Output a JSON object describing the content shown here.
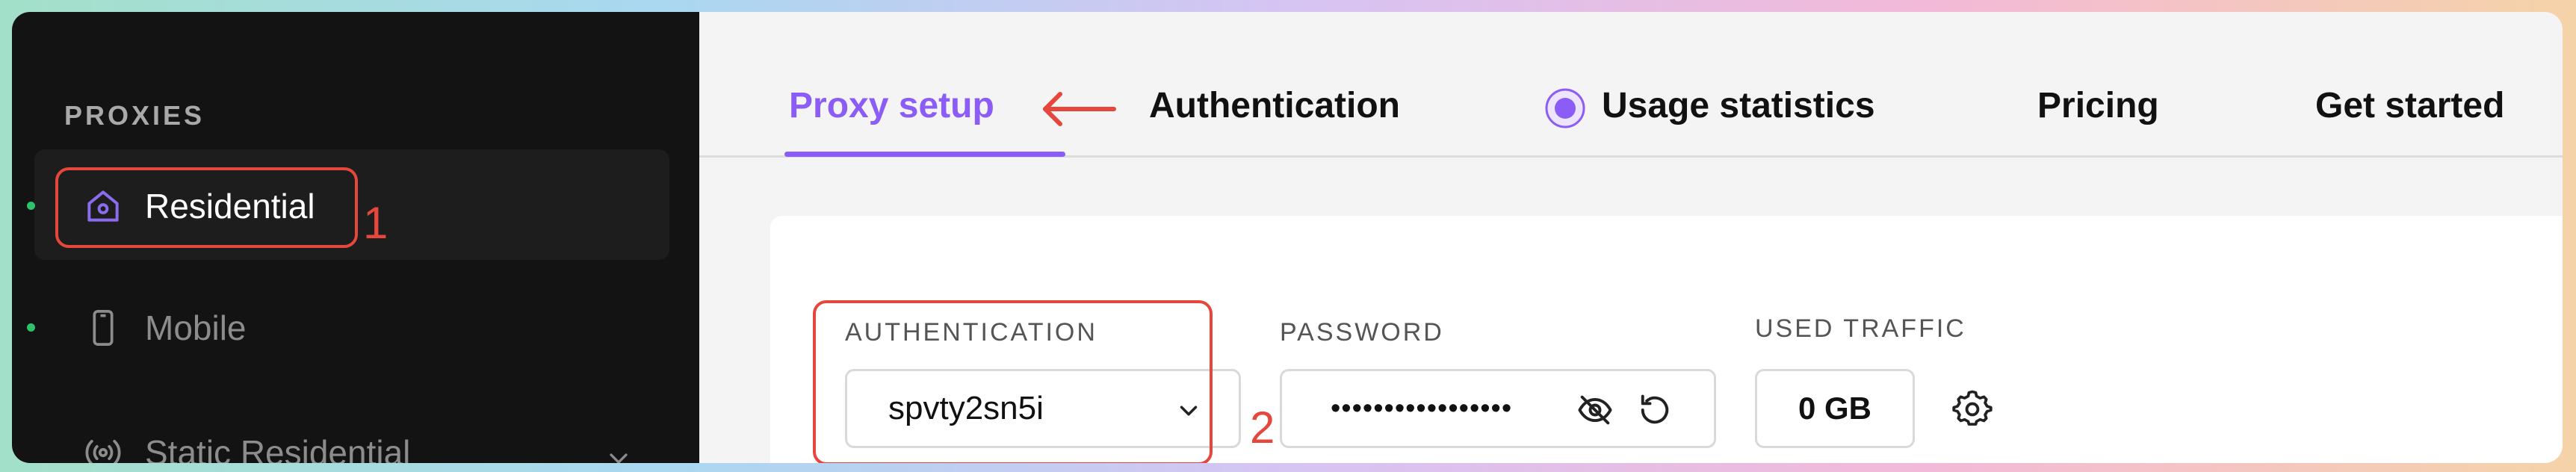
{
  "sidebar": {
    "section_title": "PROXIES",
    "items": [
      {
        "label": "Residential",
        "icon": "home-icon",
        "active": true
      },
      {
        "label": "Mobile",
        "icon": "phone-icon",
        "active": false
      },
      {
        "label": "Static Residential",
        "icon": "broadcast-icon",
        "active": false
      }
    ]
  },
  "tabs": [
    {
      "label": "Proxy setup",
      "active": true
    },
    {
      "label": "Authentication",
      "active": false
    },
    {
      "label": "Usage statistics",
      "active": false
    },
    {
      "label": "Pricing",
      "active": false
    },
    {
      "label": "Get started",
      "active": false
    }
  ],
  "form": {
    "authentication_label": "AUTHENTICATION",
    "authentication_value": "spvty2sn5i",
    "password_label": "PASSWORD",
    "password_value": "•••••••••••••••••",
    "traffic_label": "USED TRAFFIC",
    "traffic_value": "0 GB"
  },
  "annotations": {
    "one": "1",
    "two": "2"
  },
  "colors": {
    "accent": "#8b5cf6",
    "highlight": "#e5473c",
    "status_dot": "#2dc36a",
    "sidebar_bg": "#131313"
  }
}
